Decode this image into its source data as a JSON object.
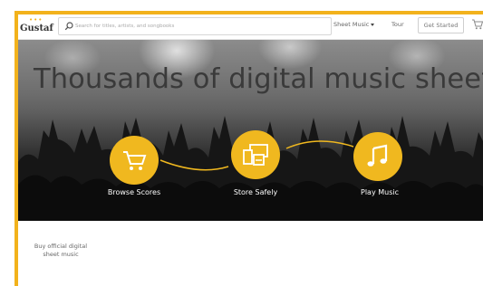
{
  "brand": {
    "name": "Gustaf",
    "accent": "#f2b21c"
  },
  "header": {
    "search_placeholder": "Search for titles, artists, and songbooks",
    "nav": {
      "sheet_music": "Sheet Music",
      "tour": "Tour",
      "get_started": "Get Started"
    },
    "icons": {
      "search": "search-icon",
      "cart": "cart-icon",
      "menu_caret": "chevron-down-icon"
    }
  },
  "hero": {
    "title": "Thousands of digital music sheets",
    "features": [
      {
        "label": "Browse Scores",
        "icon": "cart-icon"
      },
      {
        "label": "Store Safely",
        "icon": "devices-icon"
      },
      {
        "label": "Play Music",
        "icon": "music-note-icon"
      }
    ]
  },
  "content": {
    "tagline": "Buy official digital sheet music"
  }
}
